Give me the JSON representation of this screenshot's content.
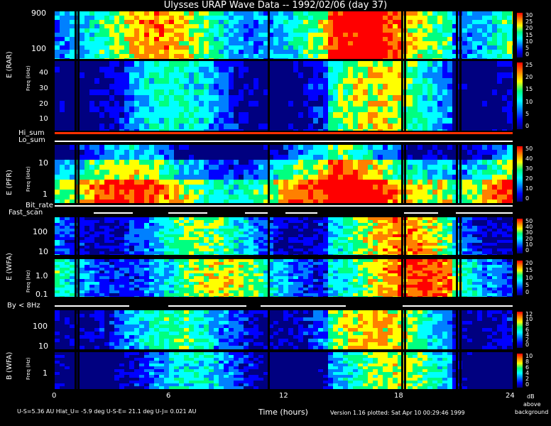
{
  "title": "Ulysses URAP Wave Data -- 1992/02/06  (day 37)",
  "panels": [
    {
      "id": "rar",
      "ylabel": "E (RAR)",
      "unit": "",
      "yticks": [
        "900",
        "100"
      ],
      "cb": [
        "30",
        "25",
        "20",
        "15",
        "10",
        "5",
        "0"
      ],
      "seed": 11,
      "bias": 0.55
    },
    {
      "id": "rar2",
      "ylabel": "",
      "unit": "Freq (kHz)",
      "yticks": [
        "40",
        "30",
        "20",
        "10"
      ],
      "cb": [
        "25",
        "20",
        "15",
        "10",
        "5",
        "0"
      ],
      "seed": 23,
      "bias": 0.25
    },
    {
      "id": "pfr",
      "ylabel": "E (PFR)",
      "unit": "Freq (kHz)",
      "yticks": [
        "10",
        "1"
      ],
      "cb": [
        "50",
        "40",
        "30",
        "20",
        "10",
        "0"
      ],
      "seed": 37,
      "bias": 0.45
    },
    {
      "id": "wfa1",
      "ylabel": "E (WFA)",
      "unit": "",
      "yticks": [
        "100",
        "10"
      ],
      "cb": [
        "50",
        "40",
        "30",
        "20",
        "10",
        "0"
      ],
      "seed": 41,
      "bias": 0.35
    },
    {
      "id": "wfa2",
      "ylabel": "",
      "unit": "Freq (Hz)",
      "yticks": [
        "1.0",
        "0.1"
      ],
      "cb": [
        "20",
        "15",
        "10",
        "5",
        "0"
      ],
      "seed": 53,
      "bias": 0.45
    },
    {
      "id": "bwfa1",
      "ylabel": "",
      "unit": "",
      "yticks": [
        "100",
        "10"
      ],
      "cb": [
        "12",
        "10",
        "8",
        "6",
        "4",
        "2",
        "0"
      ],
      "seed": 67,
      "bias": 0.3
    },
    {
      "id": "bwfa2",
      "ylabel": "B (WFA)",
      "unit": "Freq (Hz)",
      "yticks": [
        "1"
      ],
      "cb": [
        "10",
        "8",
        "6",
        "4",
        "2",
        "0"
      ],
      "seed": 79,
      "bias": 0.2
    }
  ],
  "labels": {
    "hi_sum": "Hi_sum",
    "lo_sum": "Lo_sum",
    "bit_rate": "Bit_rate",
    "fast_scan": "Fast_scan",
    "by8": "By < 8Hz"
  },
  "x_axis": {
    "label": "Time (hours)",
    "ticks": [
      "0",
      "6",
      "12",
      "18",
      "24"
    ]
  },
  "cb_units": [
    "dB",
    "above",
    "background"
  ],
  "footer": {
    "left": "U-S=5.36 AU  Hlat_U= -5.9 deg  U-S-E= 21.1 deg  U-J= 0.021 AU",
    "right": "Version 1.16 plotted: Sat Apr 10 00:29:46 1999"
  },
  "colors": {
    "bg": "#000000",
    "text": "#ffffff",
    "scale": [
      "#000080",
      "#0000ff",
      "#0080ff",
      "#00ffff",
      "#00ff80",
      "#ffff00",
      "#ff8000",
      "#ff0000"
    ]
  }
}
